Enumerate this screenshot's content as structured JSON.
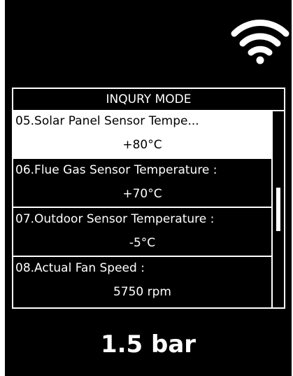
{
  "status": {
    "wifi_icon": "wifi-icon"
  },
  "menu": {
    "title": "INQURY MODE",
    "items": [
      {
        "label": "05.Solar Panel Sensor Tempe...",
        "value": "+80°C",
        "selected": true
      },
      {
        "label": "06.Flue Gas Sensor Temperature :",
        "value": "+70°C",
        "selected": false
      },
      {
        "label": "07.Outdoor Sensor Temperature :",
        "value": "-5°C",
        "selected": false
      },
      {
        "label": "08.Actual Fan Speed :",
        "value": "5750 rpm",
        "selected": false
      }
    ],
    "scroll_position": 0.5
  },
  "pressure": {
    "value": "1.5 bar"
  }
}
